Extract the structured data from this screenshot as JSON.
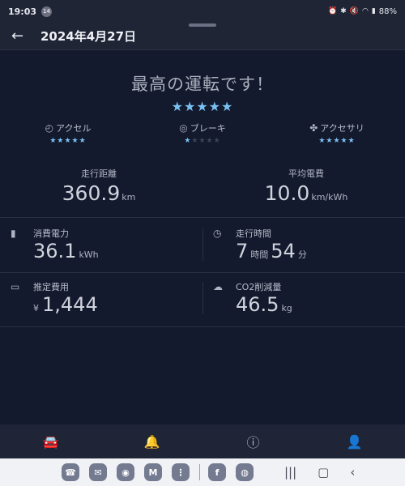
{
  "status_bar": {
    "time": "19:03",
    "notification_badge": "14",
    "icons": [
      "alarm-icon",
      "bluetooth-icon",
      "mute-icon",
      "wifi-icon",
      "signal-icon"
    ],
    "battery": "88%"
  },
  "app_bar": {
    "back_icon": "arrow-left-icon",
    "title": "2024年4月27日"
  },
  "summary": {
    "headline": "最高の運転です！",
    "overall_rating": 5,
    "overall_stars": "★★★★★"
  },
  "categories": [
    {
      "label": "アクセル",
      "icon": "gauge-icon",
      "rating": 5,
      "stars_on": "★★★★★",
      "stars_off": ""
    },
    {
      "label": "ブレーキ",
      "icon": "brake-icon",
      "rating": 1,
      "stars_on": "★",
      "stars_off": "★★★★"
    },
    {
      "label": "アクセサリ",
      "icon": "fan-icon",
      "rating": 5,
      "stars_on": "★★★★★",
      "stars_off": ""
    }
  ],
  "distance": {
    "label": "走行距離",
    "value": "360.9",
    "unit": "km"
  },
  "efficiency": {
    "label": "平均電費",
    "value": "10.0",
    "unit": "km/kWh"
  },
  "energy": {
    "label": "消費電力",
    "value": "36.1",
    "unit": "kWh",
    "icon": "battery-icon"
  },
  "drive_time": {
    "label": "走行時間",
    "hours": "7",
    "hours_unit": "時間",
    "minutes": "54",
    "minutes_unit": "分",
    "icon": "clock-icon"
  },
  "cost": {
    "label": "推定費用",
    "prefix": "¥",
    "value": "1,444",
    "icon": "card-icon"
  },
  "co2": {
    "label": "CO2削減量",
    "value": "46.5",
    "unit": "kg",
    "icon": "cloud-off-icon"
  },
  "tab_bar": [
    {
      "icon": "car-icon",
      "active": true
    },
    {
      "icon": "bell-icon",
      "active": false
    },
    {
      "icon": "help-icon",
      "active": false
    },
    {
      "icon": "person-icon",
      "active": false
    }
  ],
  "dock_apps": [
    "phone-app",
    "messages-app",
    "chrome-app",
    "gmail-app",
    "apps-grid",
    "facebook-app",
    "maps-app"
  ],
  "system_nav": [
    "recents-button",
    "home-button",
    "back-button"
  ],
  "colors": {
    "background": "#141a2e",
    "accent": "#79c1f2",
    "active_tab": "#4aa5e8"
  }
}
